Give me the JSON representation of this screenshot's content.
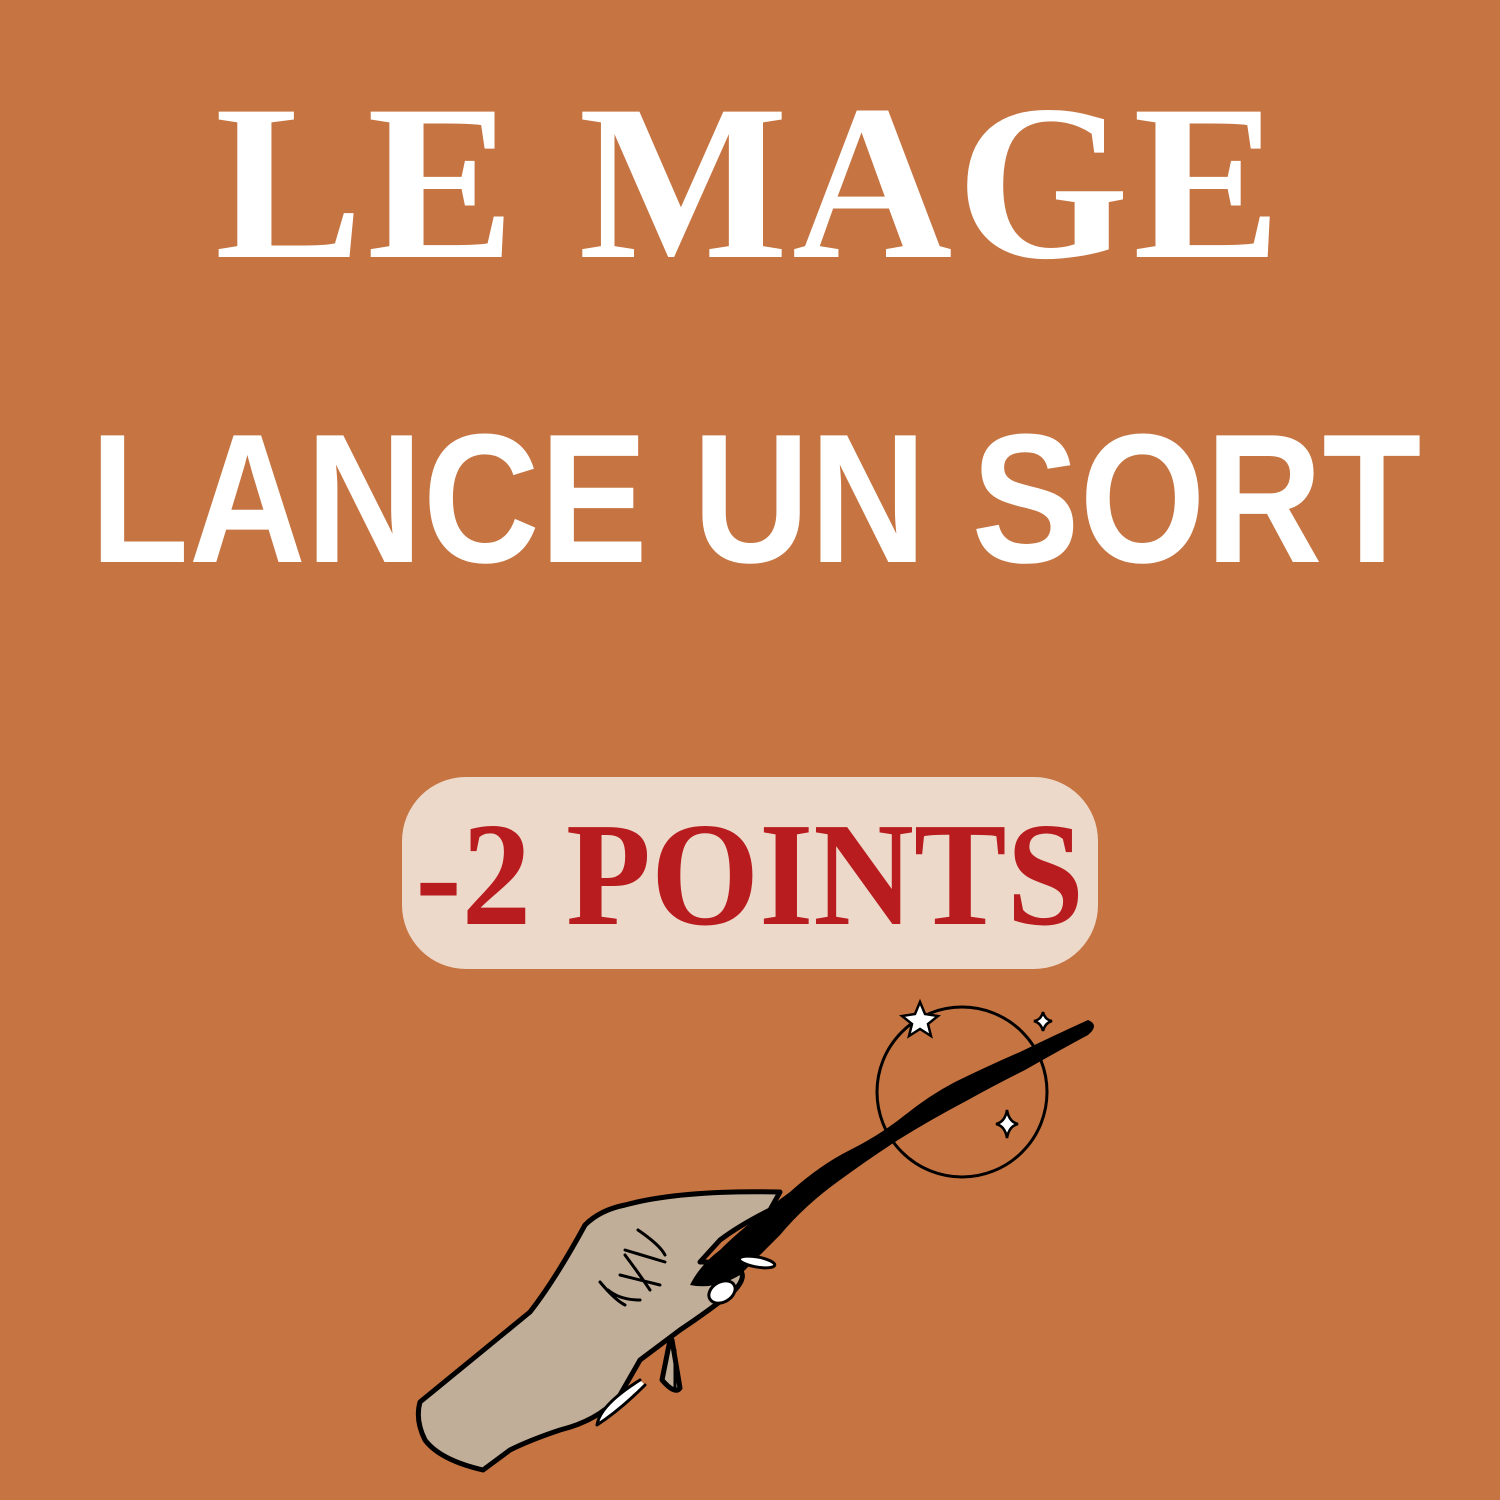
{
  "card": {
    "heading": "LE MAGE",
    "action": "LANCE UN SORT",
    "penalty": "-2 POINTS"
  },
  "illustration": {
    "icon": "hand-holding-magic-wand-icon"
  },
  "colors": {
    "background": "#C67542",
    "badge": "#EDD9CA",
    "badge_text": "#B81C1E",
    "text": "#FFFFFF",
    "skin": "#C1AE98"
  }
}
